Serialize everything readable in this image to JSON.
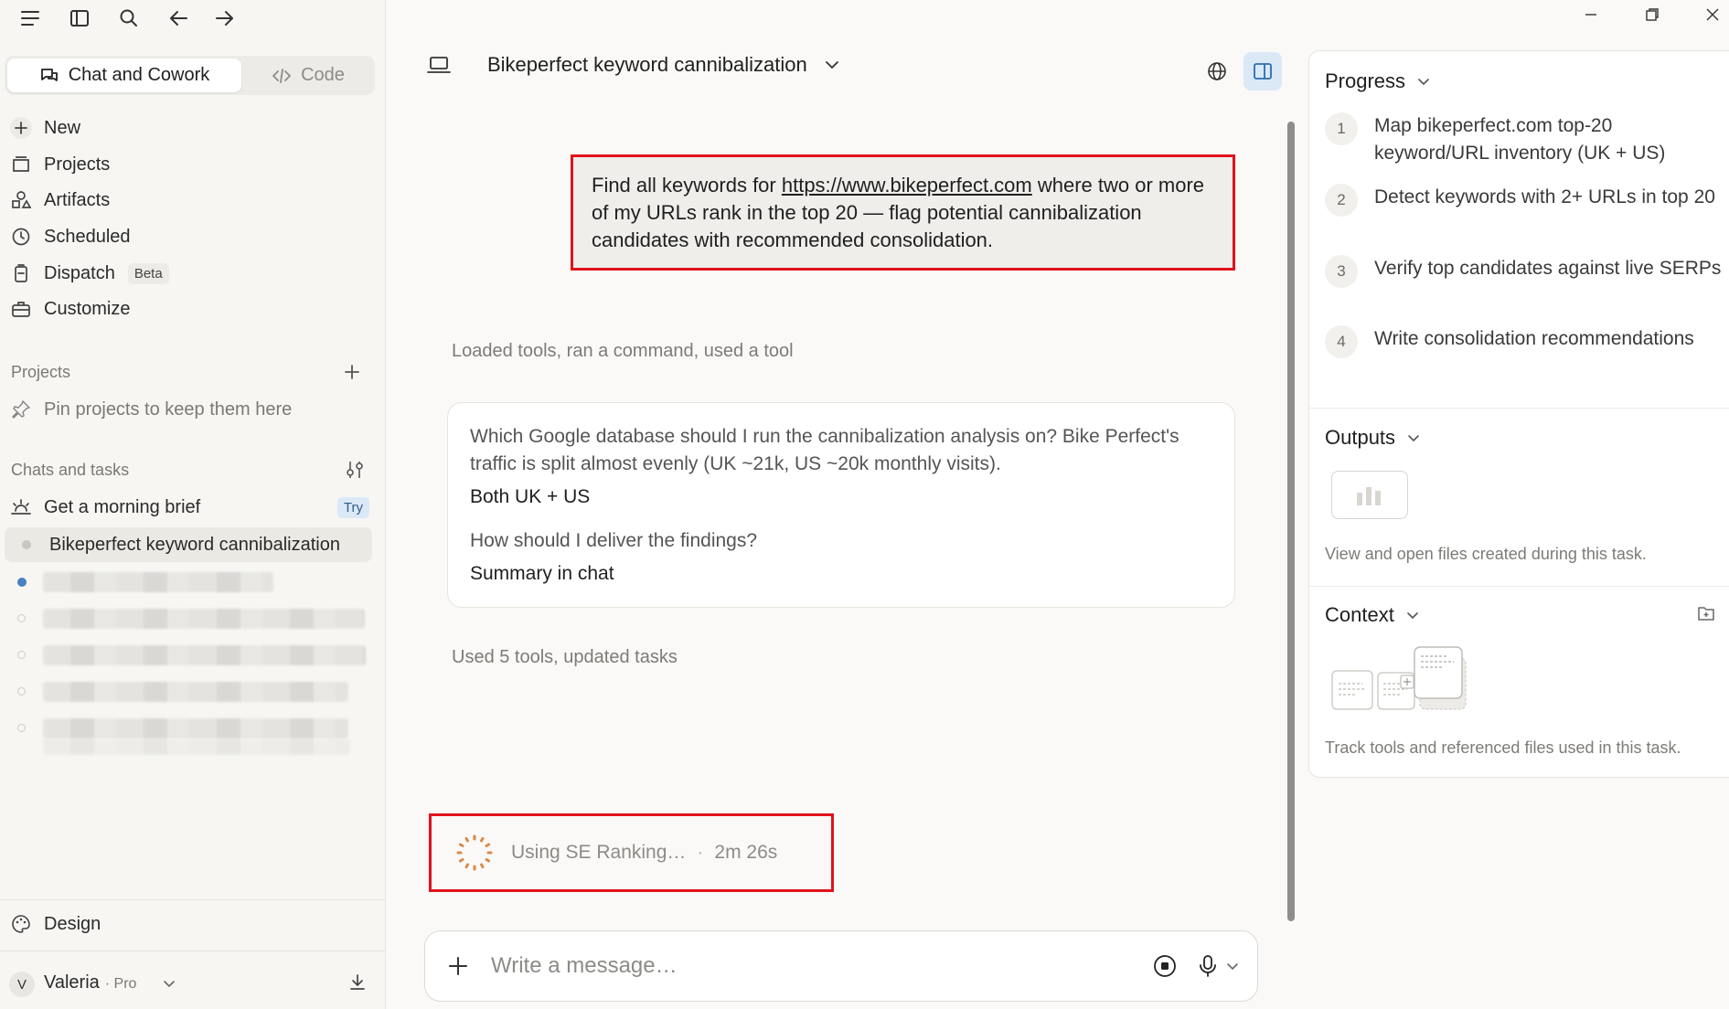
{
  "window": {
    "icons": [
      "menu-icon",
      "sidebar-toggle-icon",
      "search-icon",
      "back-arrow-icon",
      "forward-arrow-icon"
    ],
    "controls": [
      "minimize-icon",
      "restore-icon",
      "close-icon"
    ]
  },
  "sidebar": {
    "modes": {
      "chat": "Chat and Cowork",
      "code": "Code"
    },
    "nav": [
      {
        "label": "New",
        "icon": "plus-icon"
      },
      {
        "label": "Projects",
        "icon": "folder-icon"
      },
      {
        "label": "Artifacts",
        "icon": "artifacts-icon"
      },
      {
        "label": "Scheduled",
        "icon": "clock-icon"
      },
      {
        "label": "Dispatch",
        "icon": "dispatch-icon",
        "badge": "Beta"
      },
      {
        "label": "Customize",
        "icon": "briefcase-icon"
      }
    ],
    "projects_heading": "Projects",
    "projects_hint": "Pin projects to keep them here",
    "chats_heading": "Chats and tasks",
    "chats": [
      {
        "label": "Get a morning brief",
        "badge": "Try",
        "icon": "sunrise-icon"
      },
      {
        "label": "Bikeperfect keyword cannibalization",
        "active": true
      }
    ],
    "design_label": "Design",
    "user": {
      "initial": "V",
      "name": "Valeria",
      "plan": "· Pro"
    }
  },
  "main": {
    "chat_title": "Bikeperfect keyword cannibalization",
    "user_message": {
      "prefix": "Find all keywords for ",
      "link": "https://www.bikeperfect.com",
      "suffix": " where two or more of my URLs rank in the top 20 — flag potential cannibalization candidates with recommended consolidation."
    },
    "meta1": "Loaded tools, ran a command, used a tool",
    "qa": [
      {
        "q": "Which Google database should I run the cannibalization analysis on? Bike Perfect's traffic is split almost evenly (UK ~21k, US ~20k monthly visits).",
        "a": "Both UK + US"
      },
      {
        "q": "How should I deliver the findings?",
        "a": "Summary in chat"
      }
    ],
    "meta2": "Used 5 tools, updated tasks",
    "status": {
      "text": "Using SE Ranking…",
      "separator": "·",
      "time": "2m 26s"
    },
    "composer": {
      "placeholder": "Write a message…"
    }
  },
  "panel": {
    "progress_title": "Progress",
    "steps": [
      {
        "n": "1",
        "text": "Map bikeperfect.com top-20 keyword/URL inventory (UK + US)"
      },
      {
        "n": "2",
        "text": "Detect keywords with 2+ URLs in top 20"
      },
      {
        "n": "3",
        "text": "Verify top candidates against live SERPs"
      },
      {
        "n": "4",
        "text": "Write consolidation recommendations"
      }
    ],
    "outputs_title": "Outputs",
    "outputs_desc": "View and open files created during this task.",
    "context_title": "Context",
    "context_desc": "Track tools and referenced files used in this task."
  },
  "colors": {
    "highlight_border": "#e0131b",
    "accent_blue": "#dbe9f7",
    "spinner": "#d98a4a"
  }
}
